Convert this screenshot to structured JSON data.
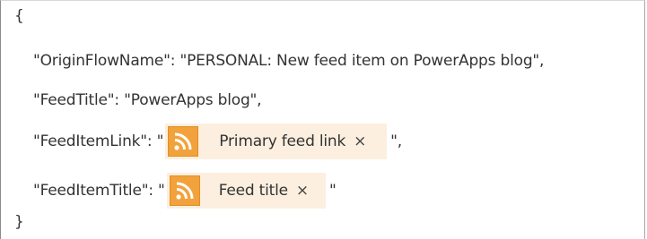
{
  "editor": {
    "open_brace": "{",
    "close_brace": "}",
    "line1": "\"OriginFlowName\": \"PERSONAL: New feed item on PowerApps blog\",",
    "line2": "\"FeedTitle\": \"PowerApps blog\",",
    "line3_prefix": "\"FeedItemLink\": \"",
    "line3_suffix": "\",",
    "line4_prefix": "\"FeedItemTitle\": \"",
    "line4_suffix": "\""
  },
  "tokens": [
    {
      "label": "Primary feed link",
      "close": "×",
      "icon": "rss-icon"
    },
    {
      "label": "Feed title",
      "close": "×",
      "icon": "rss-icon"
    }
  ],
  "colors": {
    "token_background": "#fcefdf",
    "icon_background": "#f2a23c",
    "icon_glyph": "#ffffff",
    "text": "#333333"
  }
}
